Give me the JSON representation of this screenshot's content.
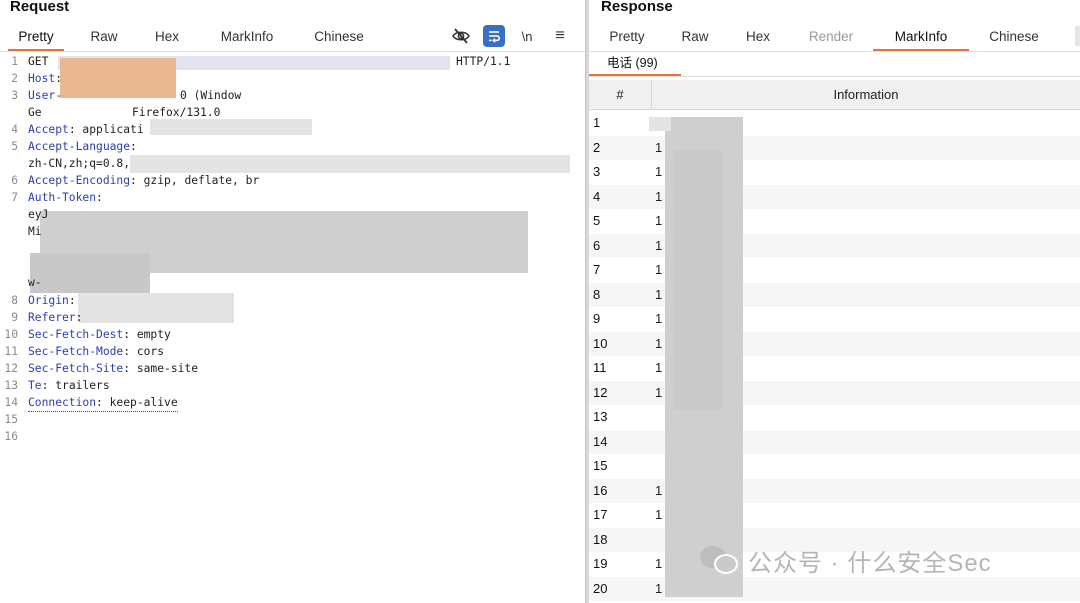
{
  "request": {
    "title": "Request",
    "tabs": [
      "Pretty",
      "Raw",
      "Hex",
      "MarkInfo",
      "Chinese"
    ],
    "active_tab": "Pretty",
    "toolbar": [
      "eye-off-icon",
      "wrap-icon",
      "newline-icon",
      "menu-icon"
    ],
    "newline_label": "\\n",
    "menu_label": "≡",
    "line_numbers": [
      "1",
      "2",
      "3",
      "4",
      "5",
      "6",
      "7",
      "8",
      "9",
      "10",
      "11",
      "12",
      "13",
      "14",
      "15",
      "16"
    ],
    "lines": {
      "l1_method": "GET",
      "l1_version": "HTTP/1.1",
      "l2_key": "Host",
      "l2_sep": ":",
      "l3_key": "User-",
      "l3_val": "0 (Window",
      "l3b_prefix": "Ge",
      "l3b_val": "Firefox/131.0",
      "l4_key": "Accept",
      "l4_val": ": applicati",
      "l5_key": "Accept-Language",
      "l5_sep": ":",
      "l5b_val": "zh-CN,zh;q=0.8,",
      "l6_key": "Accept-Encoding",
      "l6_val": ": gzip, deflate, br",
      "l7_key": "Auth-Token",
      "l7_sep": ":",
      "l7b_val": "eyJ",
      "l7c_val": "Mi",
      "l7d_val": "w-",
      "l8_key": "Origin",
      "l8_sep": ":",
      "l9_key": "Referer",
      "l9_sep": ":",
      "l10_key": "Sec-Fetch-Dest",
      "l10_val": ": empty",
      "l11_key": "Sec-Fetch-Mode",
      "l11_val": ": cors",
      "l12_key": "Sec-Fetch-Site",
      "l12_val": ": same-site",
      "l13_key": "Te",
      "l13_val": ": trailers",
      "l14_key": "Connection",
      "l14_val": ": keep-alive"
    }
  },
  "response": {
    "title": "Response",
    "tabs": [
      "Pretty",
      "Raw",
      "Hex",
      "Render",
      "MarkInfo",
      "Chinese"
    ],
    "active_tab": "MarkInfo",
    "subtab": "电话 (99)",
    "columns": [
      "#",
      "Information"
    ],
    "rows": [
      {
        "n": "1",
        "v": ""
      },
      {
        "n": "2",
        "v": "1"
      },
      {
        "n": "3",
        "v": "1"
      },
      {
        "n": "4",
        "v": "1"
      },
      {
        "n": "5",
        "v": "1"
      },
      {
        "n": "6",
        "v": "1"
      },
      {
        "n": "7",
        "v": "1"
      },
      {
        "n": "8",
        "v": "1"
      },
      {
        "n": "9",
        "v": "1"
      },
      {
        "n": "10",
        "v": "1"
      },
      {
        "n": "11",
        "v": "1"
      },
      {
        "n": "12",
        "v": "1"
      },
      {
        "n": "13",
        "v": ""
      },
      {
        "n": "14",
        "v": ""
      },
      {
        "n": "15",
        "v": ""
      },
      {
        "n": "16",
        "v": "1"
      },
      {
        "n": "17",
        "v": "1"
      },
      {
        "n": "18",
        "v": ""
      },
      {
        "n": "19",
        "v": "1"
      },
      {
        "n": "20",
        "v": "1"
      }
    ]
  },
  "watermark": {
    "text": "公众号 · 什么安全Sec",
    "icon": "wechat-icon"
  }
}
